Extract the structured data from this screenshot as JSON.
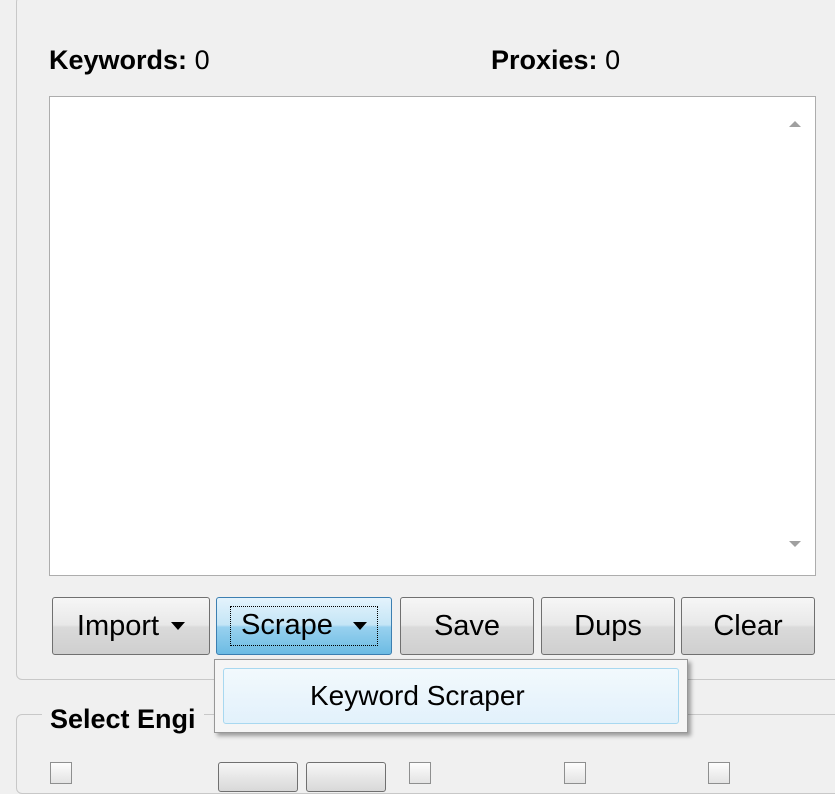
{
  "counts": {
    "keywords_label": "Keywords:",
    "keywords_value": "0",
    "proxies_label": "Proxies:",
    "proxies_value": "0"
  },
  "keyword_textarea": {
    "value": ""
  },
  "buttons": {
    "import": "Import",
    "scrape": "Scrape",
    "save": "Save",
    "dups": "Dups",
    "clear": "Clear"
  },
  "scrape_menu": {
    "items": [
      "Keyword Scraper"
    ]
  },
  "engines_group": {
    "legend": "Select Engi"
  }
}
